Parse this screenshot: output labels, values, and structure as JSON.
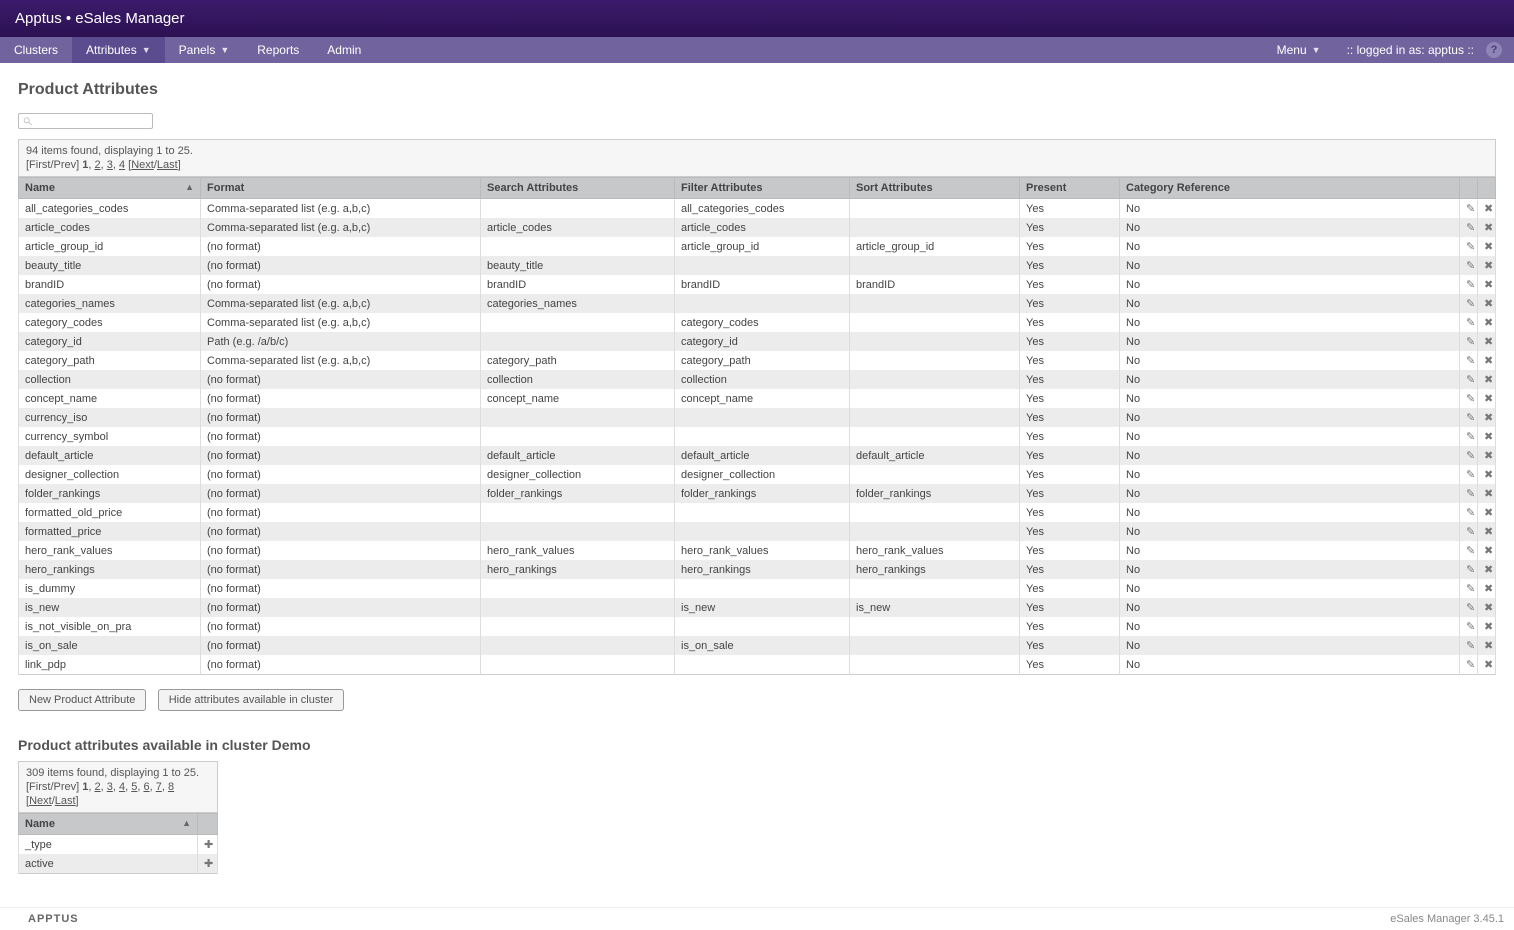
{
  "header": {
    "title": "Apptus • eSales Manager"
  },
  "nav": {
    "items": [
      {
        "label": "Clusters",
        "dropdown": false,
        "active": false
      },
      {
        "label": "Attributes",
        "dropdown": true,
        "active": true
      },
      {
        "label": "Panels",
        "dropdown": true,
        "active": false
      },
      {
        "label": "Reports",
        "dropdown": false,
        "active": false
      },
      {
        "label": "Admin",
        "dropdown": false,
        "active": false
      }
    ],
    "menu_label": "Menu",
    "logged_in_prefix": "::  logged in as:  ",
    "logged_in_user": "apptus",
    "logged_in_suffix": "  ::"
  },
  "page": {
    "title": "Product Attributes",
    "search_placeholder": ""
  },
  "main_list": {
    "meta": "94 items found, displaying 1 to 25.",
    "pager_prefix": "[First/Prev] ",
    "pager_pages": [
      "1",
      "2",
      "3",
      "4"
    ],
    "pager_suffix_open": " [",
    "pager_next": "Next",
    "pager_sep": "/",
    "pager_last": "Last",
    "pager_suffix_close": "]",
    "columns": [
      "Name",
      "Format",
      "Search Attributes",
      "Filter Attributes",
      "Sort Attributes",
      "Present",
      "Category Reference"
    ],
    "rows": [
      {
        "name": "all_categories_codes",
        "format": "Comma-separated list (e.g. a,b,c)",
        "search": "",
        "filter": "all_categories_codes",
        "sort": "",
        "present": "Yes",
        "cat": "No"
      },
      {
        "name": "article_codes",
        "format": "Comma-separated list (e.g. a,b,c)",
        "search": "article_codes",
        "filter": "article_codes",
        "sort": "",
        "present": "Yes",
        "cat": "No"
      },
      {
        "name": "article_group_id",
        "format": "(no format)",
        "search": "",
        "filter": "article_group_id",
        "sort": "article_group_id",
        "present": "Yes",
        "cat": "No"
      },
      {
        "name": "beauty_title",
        "format": "(no format)",
        "search": "beauty_title",
        "filter": "",
        "sort": "",
        "present": "Yes",
        "cat": "No"
      },
      {
        "name": "brandID",
        "format": "(no format)",
        "search": "brandID",
        "filter": "brandID",
        "sort": "brandID",
        "present": "Yes",
        "cat": "No"
      },
      {
        "name": "categories_names",
        "format": "Comma-separated list (e.g. a,b,c)",
        "search": "categories_names",
        "filter": "",
        "sort": "",
        "present": "Yes",
        "cat": "No"
      },
      {
        "name": "category_codes",
        "format": "Comma-separated list (e.g. a,b,c)",
        "search": "",
        "filter": "category_codes",
        "sort": "",
        "present": "Yes",
        "cat": "No"
      },
      {
        "name": "category_id",
        "format": "Path (e.g. /a/b/c)",
        "search": "",
        "filter": "category_id",
        "sort": "",
        "present": "Yes",
        "cat": "No"
      },
      {
        "name": "category_path",
        "format": "Comma-separated list (e.g. a,b,c)",
        "search": "category_path",
        "filter": "category_path",
        "sort": "",
        "present": "Yes",
        "cat": "No"
      },
      {
        "name": "collection",
        "format": "(no format)",
        "search": "collection",
        "filter": "collection",
        "sort": "",
        "present": "Yes",
        "cat": "No"
      },
      {
        "name": "concept_name",
        "format": "(no format)",
        "search": "concept_name",
        "filter": "concept_name",
        "sort": "",
        "present": "Yes",
        "cat": "No"
      },
      {
        "name": "currency_iso",
        "format": "(no format)",
        "search": "",
        "filter": "",
        "sort": "",
        "present": "Yes",
        "cat": "No"
      },
      {
        "name": "currency_symbol",
        "format": "(no format)",
        "search": "",
        "filter": "",
        "sort": "",
        "present": "Yes",
        "cat": "No"
      },
      {
        "name": "default_article",
        "format": "(no format)",
        "search": "default_article",
        "filter": "default_article",
        "sort": "default_article",
        "present": "Yes",
        "cat": "No"
      },
      {
        "name": "designer_collection",
        "format": "(no format)",
        "search": "designer_collection",
        "filter": "designer_collection",
        "sort": "",
        "present": "Yes",
        "cat": "No"
      },
      {
        "name": "folder_rankings",
        "format": "(no format)",
        "search": "folder_rankings",
        "filter": "folder_rankings",
        "sort": "folder_rankings",
        "present": "Yes",
        "cat": "No"
      },
      {
        "name": "formatted_old_price",
        "format": "(no format)",
        "search": "",
        "filter": "",
        "sort": "",
        "present": "Yes",
        "cat": "No"
      },
      {
        "name": "formatted_price",
        "format": "(no format)",
        "search": "",
        "filter": "",
        "sort": "",
        "present": "Yes",
        "cat": "No"
      },
      {
        "name": "hero_rank_values",
        "format": "(no format)",
        "search": "hero_rank_values",
        "filter": "hero_rank_values",
        "sort": "hero_rank_values",
        "present": "Yes",
        "cat": "No"
      },
      {
        "name": "hero_rankings",
        "format": "(no format)",
        "search": "hero_rankings",
        "filter": "hero_rankings",
        "sort": "hero_rankings",
        "present": "Yes",
        "cat": "No"
      },
      {
        "name": "is_dummy",
        "format": "(no format)",
        "search": "",
        "filter": "",
        "sort": "",
        "present": "Yes",
        "cat": "No"
      },
      {
        "name": "is_new",
        "format": "(no format)",
        "search": "",
        "filter": "is_new",
        "sort": "is_new",
        "present": "Yes",
        "cat": "No"
      },
      {
        "name": "is_not_visible_on_pra",
        "format": "(no format)",
        "search": "",
        "filter": "",
        "sort": "",
        "present": "Yes",
        "cat": "No"
      },
      {
        "name": "is_on_sale",
        "format": "(no format)",
        "search": "",
        "filter": "is_on_sale",
        "sort": "",
        "present": "Yes",
        "cat": "No"
      },
      {
        "name": "link_pdp",
        "format": "(no format)",
        "search": "",
        "filter": "",
        "sort": "",
        "present": "Yes",
        "cat": "No"
      }
    ]
  },
  "buttons": {
    "new_attr": "New Product Attribute",
    "hide_avail": "Hide attributes available in cluster"
  },
  "cluster_section": {
    "title": "Product attributes available in cluster Demo",
    "meta": "309 items found, displaying 1 to 25.",
    "pager_prefix": "[First/Prev] ",
    "pager_pages": [
      "1",
      "2",
      "3",
      "4",
      "5",
      "6",
      "7",
      "8"
    ],
    "pager_line2_open": "[",
    "pager_next": "Next",
    "pager_sep": "/",
    "pager_last": "Last",
    "pager_line2_close": "]",
    "column": "Name",
    "rows": [
      {
        "name": "_type"
      },
      {
        "name": "active"
      }
    ]
  },
  "footer": {
    "brand": "APPTUS",
    "version": "eSales Manager 3.45.1"
  }
}
